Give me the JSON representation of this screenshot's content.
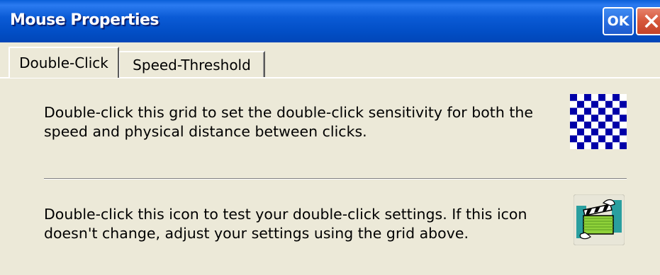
{
  "window": {
    "title": "Mouse Properties",
    "ok_label": "OK",
    "close_icon": "close-icon",
    "colors": {
      "titlebar": "#0350c8",
      "background": "#ece9d8",
      "close_button": "#d6573b",
      "grid": "#0000a8"
    }
  },
  "tabs": [
    {
      "label": "Double-Click",
      "active": true
    },
    {
      "label": "Speed-Threshold",
      "active": false
    }
  ],
  "double_click": {
    "grid_description": "Double-click this grid to set the double-click sensitivity for both the speed and physical distance between clicks.",
    "grid_icon": "checkerboard-grid-icon",
    "test_description": "Double-click this icon to test your double-click settings. If this icon doesn't change, adjust your settings using the grid above.",
    "test_icon": "clapperboard-test-icon"
  }
}
